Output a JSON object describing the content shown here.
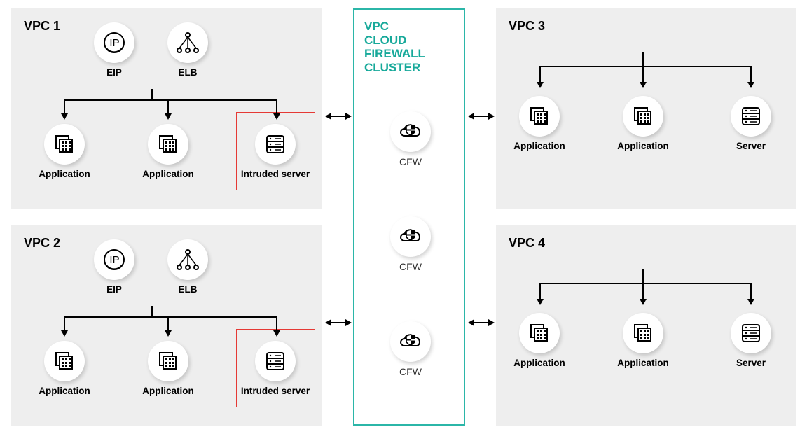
{
  "center": {
    "title": "VPC\nCLOUD\nFIREWALL\nCLUSTER",
    "nodes": [
      {
        "label": "CFW"
      },
      {
        "label": "CFW"
      },
      {
        "label": "CFW"
      }
    ]
  },
  "vpc": [
    {
      "title": "VPC 1",
      "top_nodes": [
        {
          "label": "EIP",
          "icon": "eip"
        },
        {
          "label": "ELB",
          "icon": "elb"
        }
      ],
      "bottom_nodes": [
        {
          "label": "Application",
          "icon": "app"
        },
        {
          "label": "Application",
          "icon": "app"
        },
        {
          "label": "Intruded server",
          "icon": "server",
          "intruded": true
        }
      ]
    },
    {
      "title": "VPC 2",
      "top_nodes": [
        {
          "label": "EIP",
          "icon": "eip"
        },
        {
          "label": "ELB",
          "icon": "elb"
        }
      ],
      "bottom_nodes": [
        {
          "label": "Application",
          "icon": "app"
        },
        {
          "label": "Application",
          "icon": "app"
        },
        {
          "label": "Intruded server",
          "icon": "server",
          "intruded": true
        }
      ]
    },
    {
      "title": "VPC 3",
      "bottom_nodes": [
        {
          "label": "Application",
          "icon": "app"
        },
        {
          "label": "Application",
          "icon": "app"
        },
        {
          "label": "Server",
          "icon": "server"
        }
      ]
    },
    {
      "title": "VPC 4",
      "bottom_nodes": [
        {
          "label": "Application",
          "icon": "app"
        },
        {
          "label": "Application",
          "icon": "app"
        },
        {
          "label": "Server",
          "icon": "server"
        }
      ]
    }
  ]
}
